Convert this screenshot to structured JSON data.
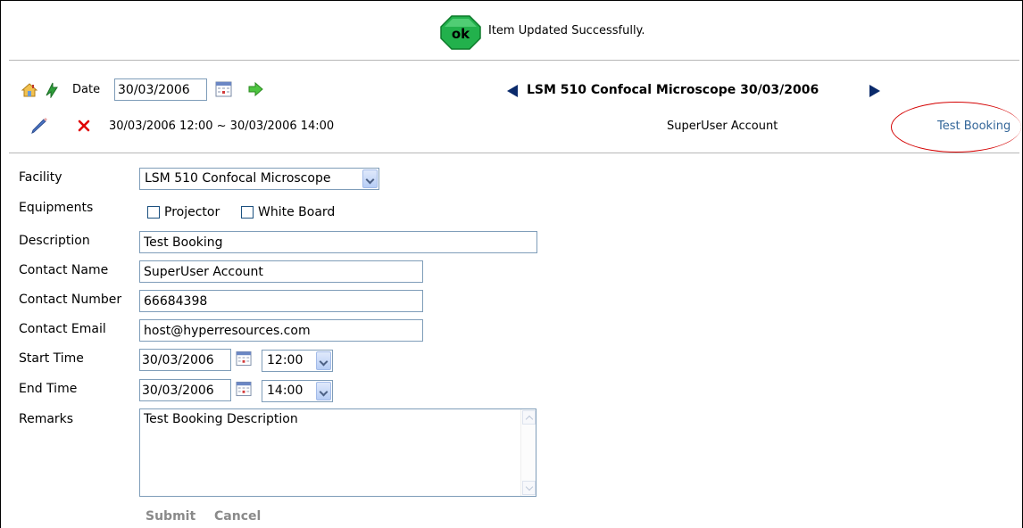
{
  "status": {
    "badge_text": "ok",
    "message": "Item Updated Successfully."
  },
  "toolbar": {
    "date_label": "Date",
    "date_value": "30/03/2006",
    "nav_title": "LSM 510 Confocal Microscope  30/03/2006"
  },
  "booking": {
    "range": "30/03/2006 12:00 ~ 30/03/2006 14:00",
    "user": "SuperUser Account",
    "link_text": "Test Booking"
  },
  "form": {
    "facility_label": "Facility",
    "facility_value": "LSM 510 Confocal Microscope",
    "equipments_label": "Equipments",
    "equipment_options": [
      "Projector",
      "White Board"
    ],
    "description_label": "Description",
    "description_value": "Test Booking",
    "contact_name_label": "Contact Name",
    "contact_name_value": "SuperUser Account",
    "contact_number_label": "Contact Number",
    "contact_number_value": "66684398",
    "contact_email_label": "Contact Email",
    "contact_email_value": "host@hyperresources.com",
    "start_label": "Start Time",
    "start_date": "30/03/2006",
    "start_time": "12:00",
    "end_label": "End Time",
    "end_date": "30/03/2006",
    "end_time": "14:00",
    "remarks_label": "Remarks",
    "remarks_value": "Test Booking Description",
    "submit_label": "Submit",
    "cancel_label": "Cancel"
  },
  "colors": {
    "ok_green": "#22b14c",
    "link_blue": "#336699",
    "highlight_red": "#d40000",
    "input_border": "#7f9db9"
  }
}
